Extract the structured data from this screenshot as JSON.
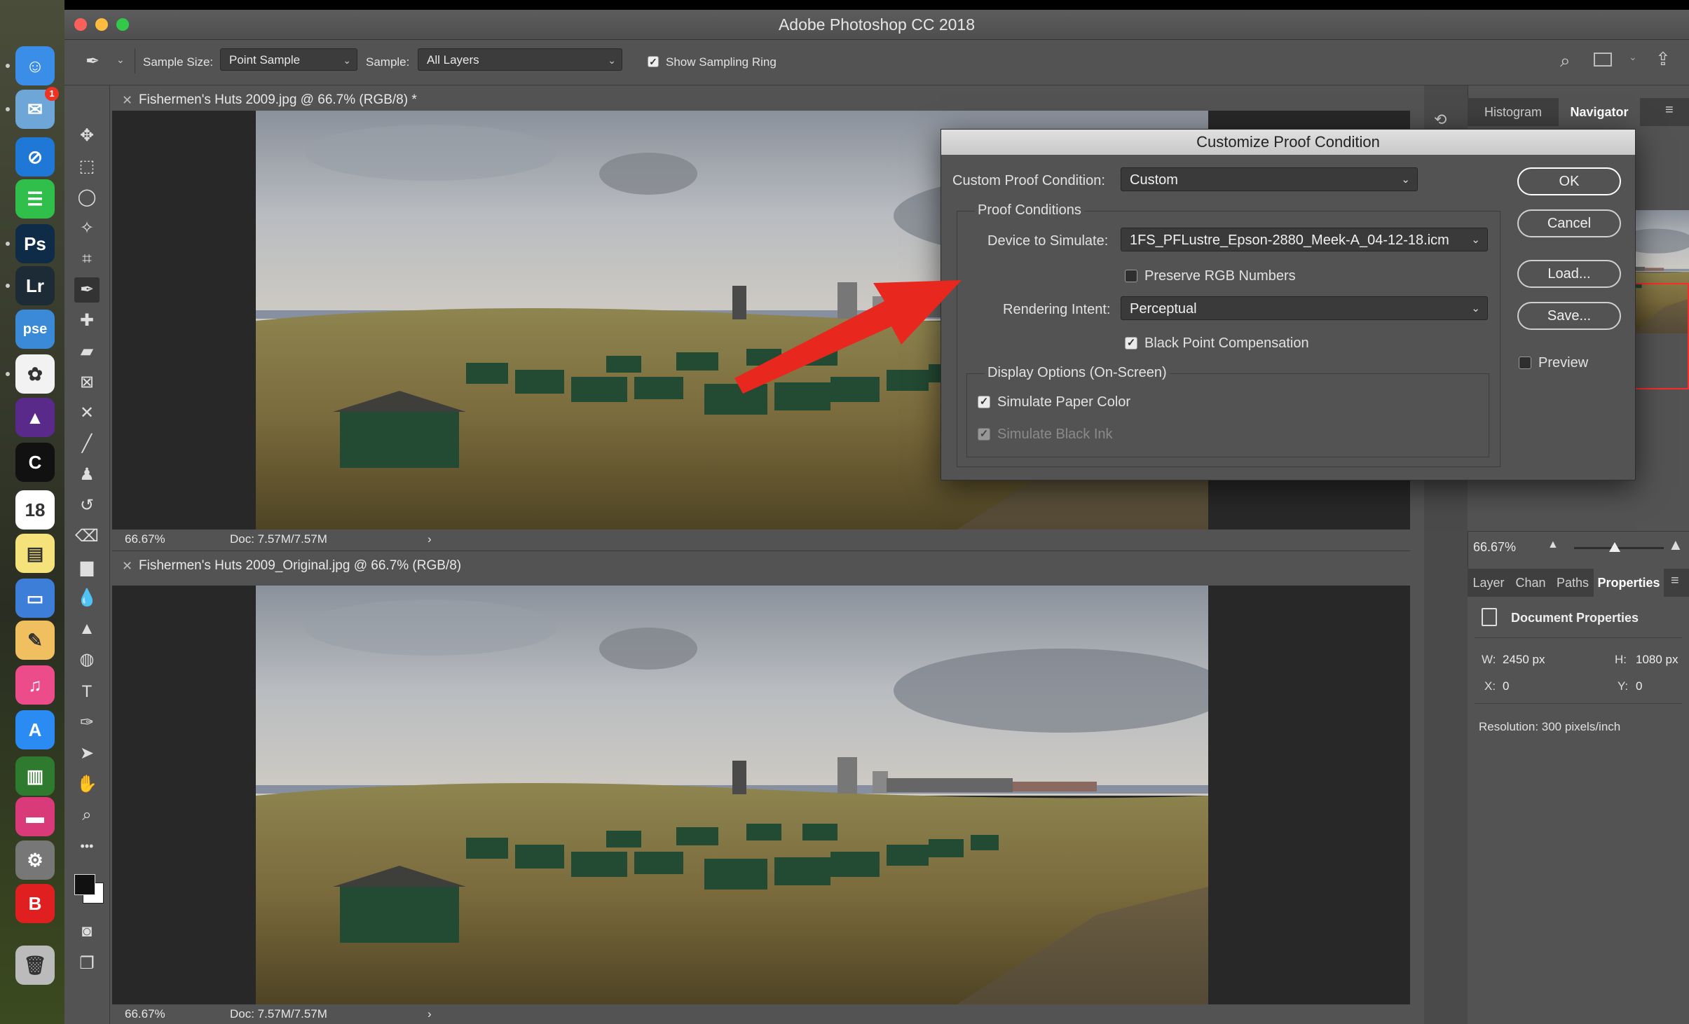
{
  "app": {
    "title": "Adobe Photoshop CC 2018",
    "colors": {
      "close": "#fc605b",
      "minimize": "#fdbc40",
      "maximize": "#34c84a",
      "annotation_arrow": "#e8281e",
      "navigator_box": "#ff2b2b"
    }
  },
  "dock": {
    "items": [
      {
        "name": "finder-icon",
        "glyph": "☺",
        "bg": "#3b8ee8"
      },
      {
        "name": "mail-icon",
        "glyph": "✉",
        "bg": "#6fa6d8",
        "badge": "1"
      },
      {
        "name": "safari-icon",
        "glyph": "⊘",
        "bg": "#1f78d6"
      },
      {
        "name": "messages-icon",
        "glyph": "☰",
        "bg": "#2fbf4a"
      },
      {
        "name": "photoshop-icon",
        "glyph": "Ps",
        "bg": "#0e2b48"
      },
      {
        "name": "lightroom-icon",
        "glyph": "Lr",
        "bg": "#1c2b36"
      },
      {
        "name": "photoshop-elements-icon",
        "glyph": "pse",
        "bg": "#3a8ad8"
      },
      {
        "name": "photos-icon",
        "glyph": "✿",
        "bg": "#f2f2f2"
      },
      {
        "name": "affinity-photo-icon",
        "glyph": "▲",
        "bg": "#5a2a8a"
      },
      {
        "name": "nikon-capture-icon",
        "glyph": "C",
        "bg": "#111111"
      },
      {
        "name": "calendar-icon",
        "glyph": "18",
        "bg": "#ffffff"
      },
      {
        "name": "notes-icon",
        "glyph": "▤",
        "bg": "#f6e27a"
      },
      {
        "name": "keynote-icon",
        "glyph": "▭",
        "bg": "#3d7fd8"
      },
      {
        "name": "preview-icon",
        "glyph": "✎",
        "bg": "#f0c060"
      },
      {
        "name": "itunes-icon",
        "glyph": "♫",
        "bg": "#ec4d8a"
      },
      {
        "name": "app-store-icon",
        "glyph": "A",
        "bg": "#2a8cf2"
      },
      {
        "name": "memory-icon",
        "glyph": "▥",
        "bg": "#2e7a2e"
      },
      {
        "name": "display-icon",
        "glyph": "▬",
        "bg": "#d83a7a"
      },
      {
        "name": "system-preferences-icon",
        "glyph": "⚙",
        "bg": "#777777"
      },
      {
        "name": "bitdefender-icon",
        "glyph": "B",
        "bg": "#e02020"
      },
      {
        "name": "trash-icon",
        "glyph": "🗑",
        "bg": "#bbbbbb"
      }
    ]
  },
  "options_bar": {
    "sample_size_label": "Sample Size:",
    "sample_size_value": "Point Sample",
    "sample_label": "Sample:",
    "sample_value": "All Layers",
    "show_sampling_ring_label": "Show Sampling Ring",
    "show_sampling_ring_checked": true
  },
  "tools": [
    "move-icon",
    "marquee-icon",
    "lasso-icon",
    "magic-wand-icon",
    "crop-icon",
    "eyedropper-icon",
    "healing-brush-icon",
    "patch-icon",
    "frame-icon",
    "content-aware-move-icon",
    "brush-icon",
    "clone-stamp-icon",
    "history-brush-icon",
    "eraser-icon",
    "gradient-icon",
    "blur-icon",
    "sharpen-icon",
    "dodge-icon",
    "type-icon",
    "pen-icon",
    "path-selection-icon",
    "hand-icon",
    "zoom-icon",
    "more-tools-icon"
  ],
  "tool_glyphs": [
    "✥",
    "⬚",
    "◯",
    "✧",
    "⌗",
    "✒",
    "✚",
    "▰",
    "⊠",
    "✕",
    "╱",
    "♟",
    "↺",
    "⌫",
    "▆",
    "💧",
    "▲",
    "◍",
    "T",
    "✑",
    "➤",
    "✋",
    "⌕",
    "•••"
  ],
  "documents": [
    {
      "tab": "Fishermen's Huts 2009.jpg @ 66.7% (RGB/8) *",
      "zoom": "66.67%",
      "doc": "Doc: 7.57M/7.57M"
    },
    {
      "tab": "Fishermen's Huts 2009_Original.jpg @ 66.7% (RGB/8)",
      "zoom": "66.67%",
      "doc": "Doc: 7.57M/7.57M"
    }
  ],
  "panels": {
    "top_tabs": [
      "Histogram",
      "Navigator"
    ],
    "top_active": "Navigator",
    "navigator_zoom": "66.67%",
    "navigator_slider": 0.45,
    "bottom_tabs": [
      "Layer",
      "Chan",
      "Paths",
      "Properties"
    ],
    "bottom_active": "Properties",
    "properties": {
      "section": "Document Properties",
      "w_label": "W:",
      "w_value": "2450 px",
      "h_label": "H:",
      "h_value": "1080 px",
      "x_label": "X:",
      "x_value": "0",
      "y_label": "Y:",
      "y_value": "0",
      "resolution": "Resolution: 300 pixels/inch"
    }
  },
  "dialog": {
    "title": "Customize Proof Condition",
    "custom_condition_label": "Custom Proof Condition:",
    "custom_condition_value": "Custom",
    "proof_conditions_title": "Proof Conditions",
    "device_label": "Device to Simulate:",
    "device_value": "1FS_PFLustre_Epson-2880_Meek-A_04-12-18.icm",
    "preserve_rgb_label": "Preserve RGB Numbers",
    "preserve_rgb_checked": false,
    "rendering_intent_label": "Rendering Intent:",
    "rendering_intent_value": "Perceptual",
    "bpc_label": "Black Point Compensation",
    "bpc_checked": true,
    "display_options_title": "Display Options (On-Screen)",
    "simulate_paper_label": "Simulate Paper Color",
    "simulate_paper_checked": true,
    "simulate_ink_label": "Simulate Black Ink",
    "simulate_ink_checked": true,
    "simulate_ink_disabled": true,
    "buttons": {
      "ok": "OK",
      "cancel": "Cancel",
      "load": "Load...",
      "save": "Save..."
    },
    "preview_label": "Preview",
    "preview_checked": false
  }
}
